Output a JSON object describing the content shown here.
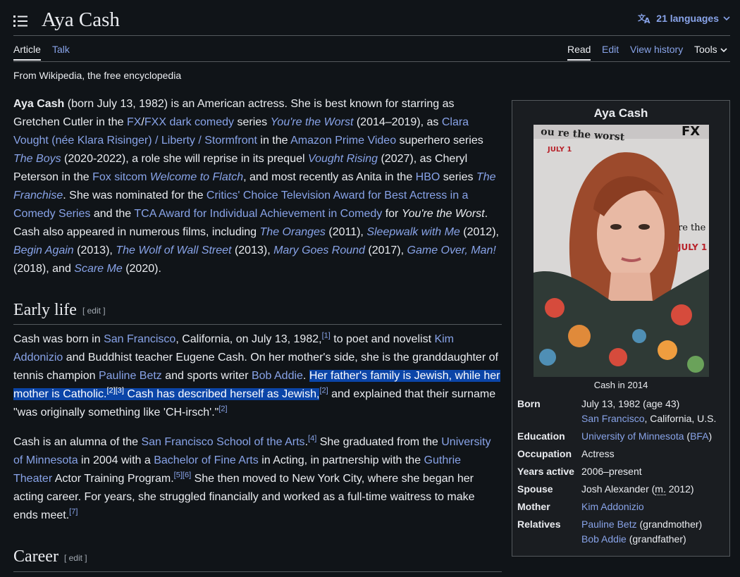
{
  "header": {
    "title": "Aya Cash",
    "languages": "21 languages"
  },
  "tabs": {
    "article": "Article",
    "talk": "Talk",
    "read": "Read",
    "edit": "Edit",
    "history": "View history",
    "tools": "Tools"
  },
  "tagline": "From Wikipedia, the free encyclopedia",
  "lead": {
    "name": "Aya Cash",
    "t1": " (born July 13, 1982) is an American actress. She is best known for starring as Gretchen Cutler in the ",
    "fx": "FX",
    "t2": "/",
    "fxx": "FXX",
    "t3": " ",
    "dark": "dark comedy",
    "t4": " series ",
    "worst": "You're the Worst",
    "t5": " (2014–2019), as ",
    "clara": "Clara Vought (née Klara Risinger) / Liberty / Stormfront",
    "t6": " in the ",
    "prime": "Amazon Prime Video",
    "t7": " superhero series ",
    "boys": "The Boys",
    "t8": " (2020-2022), a role she will reprise in its prequel ",
    "vought": "Vought Rising",
    "t9": " (2027), as Cheryl Peterson in the ",
    "fox": "Fox",
    "t10": " ",
    "sitcom": "sitcom",
    "t11": " ",
    "flatch": "Welcome to Flatch",
    "t12": ", and most recently as Anita in the ",
    "hbo": "HBO",
    "t13": " series ",
    "franchise": "The Franchise",
    "t14": ". She was nominated for the ",
    "critics": "Critics' Choice Television Award for Best Actress in a Comedy Series",
    "t15": " and the ",
    "tca": "TCA Award for Individual Achievement in Comedy",
    "t16": " for ",
    "worst2": "You're the Worst",
    "t17": ". Cash also appeared in numerous films, including ",
    "oranges": "The Oranges",
    "t18": " (2011), ",
    "sleepwalk": "Sleepwalk with Me",
    "t19": " (2012), ",
    "begin": "Begin Again",
    "t20": " (2013), ",
    "wolf": "The Wolf of Wall Street",
    "t21": " (2013), ",
    "mary": "Mary Goes Round",
    "t22": " (2017), ",
    "gameover": "Game Over, Man!",
    "t23": " (2018), and ",
    "scare": "Scare Me",
    "t24": " (2020)."
  },
  "early": {
    "heading": "Early life",
    "edit": "[ edit ]",
    "p1": {
      "t1": "Cash was born in ",
      "sf": "San Francisco",
      "t2": ", California, on July 13, 1982,",
      "r1": "[1]",
      "t3": " to poet and novelist ",
      "kim": "Kim Addonizio",
      "t4": " and Buddhist teacher Eugene Cash. On her mother's side, she is the granddaughter of tennis champion ",
      "betz": "Pauline Betz",
      "t5": " and sports writer ",
      "addie": "Bob Addie",
      "t6": ". ",
      "s1": "Her father's family is Jewish, while her mother is Catholic.",
      "r2": "[2]",
      "r3": "[3]",
      "s2": " Cash has described herself as Jewish,",
      "r4": "[2]",
      "t7": " and explained that their surname \"was originally something like 'CH-irsch'.\"",
      "r5": "[2]"
    },
    "p2": {
      "t1": "Cash is an alumna of the ",
      "sfsa": "San Francisco School of the Arts",
      "t2": ".",
      "r1": "[4]",
      "t3": " She graduated from the ",
      "umn": "University of Minnesota",
      "t4": " in 2004 with a ",
      "bfa": "Bachelor of Fine Arts",
      "t5": " in Acting, in partnership with the ",
      "guthrie": "Guthrie Theater",
      "t6": " Actor Training Program.",
      "r2": "[5]",
      "r3": "[6]",
      "t7": " She then moved to New York City, where she began her acting career. For years, she struggled financially and worked as a full-time waitress to make ends meet.",
      "r4": "[7]"
    }
  },
  "career": {
    "heading": "Career",
    "edit": "[ edit ]"
  },
  "infobox": {
    "title": "Aya Cash",
    "caption": "Cash in 2014",
    "born_label": "Born",
    "born_date": "July 13, 1982 (age 43)",
    "born_city": "San Francisco",
    "born_rest": ", California, U.S.",
    "edu_label": "Education",
    "edu_uni": "University of Minnesota",
    "edu_open": " (",
    "edu_deg": "BFA",
    "edu_close": ")",
    "occ_label": "Occupation",
    "occ": "Actress",
    "years_label": "Years active",
    "years": "2006–present",
    "spouse_label": "Spouse",
    "spouse1": "Josh Alexander (",
    "spouse_m": "m.",
    "spouse2": " 2012)",
    "mother_label": "Mother",
    "mother": "Kim Addonizio",
    "rel_label": "Relatives",
    "rel1": "Pauline Betz",
    "rel1_note": " (grandmother)",
    "rel2": "Bob Addie",
    "rel2_note": " (grandfather)"
  }
}
